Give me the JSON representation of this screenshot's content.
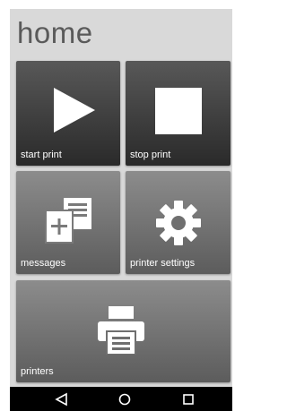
{
  "screen": {
    "title": "home"
  },
  "tiles": [
    {
      "label": "start print",
      "icon": "play-icon"
    },
    {
      "label": "stop print",
      "icon": "stop-icon"
    },
    {
      "label": "messages",
      "icon": "messages-icon"
    },
    {
      "label": "printer settings",
      "icon": "gear-icon"
    },
    {
      "label": "printers",
      "icon": "printer-icon"
    }
  ],
  "navbar": {
    "buttons": [
      "back-icon",
      "home-icon",
      "recents-icon"
    ]
  },
  "colors": {
    "background": "#d9d9d9",
    "tile_dark": "#3a3a3a",
    "tile_light": "#7a7a7a",
    "navbar": "#000000"
  }
}
